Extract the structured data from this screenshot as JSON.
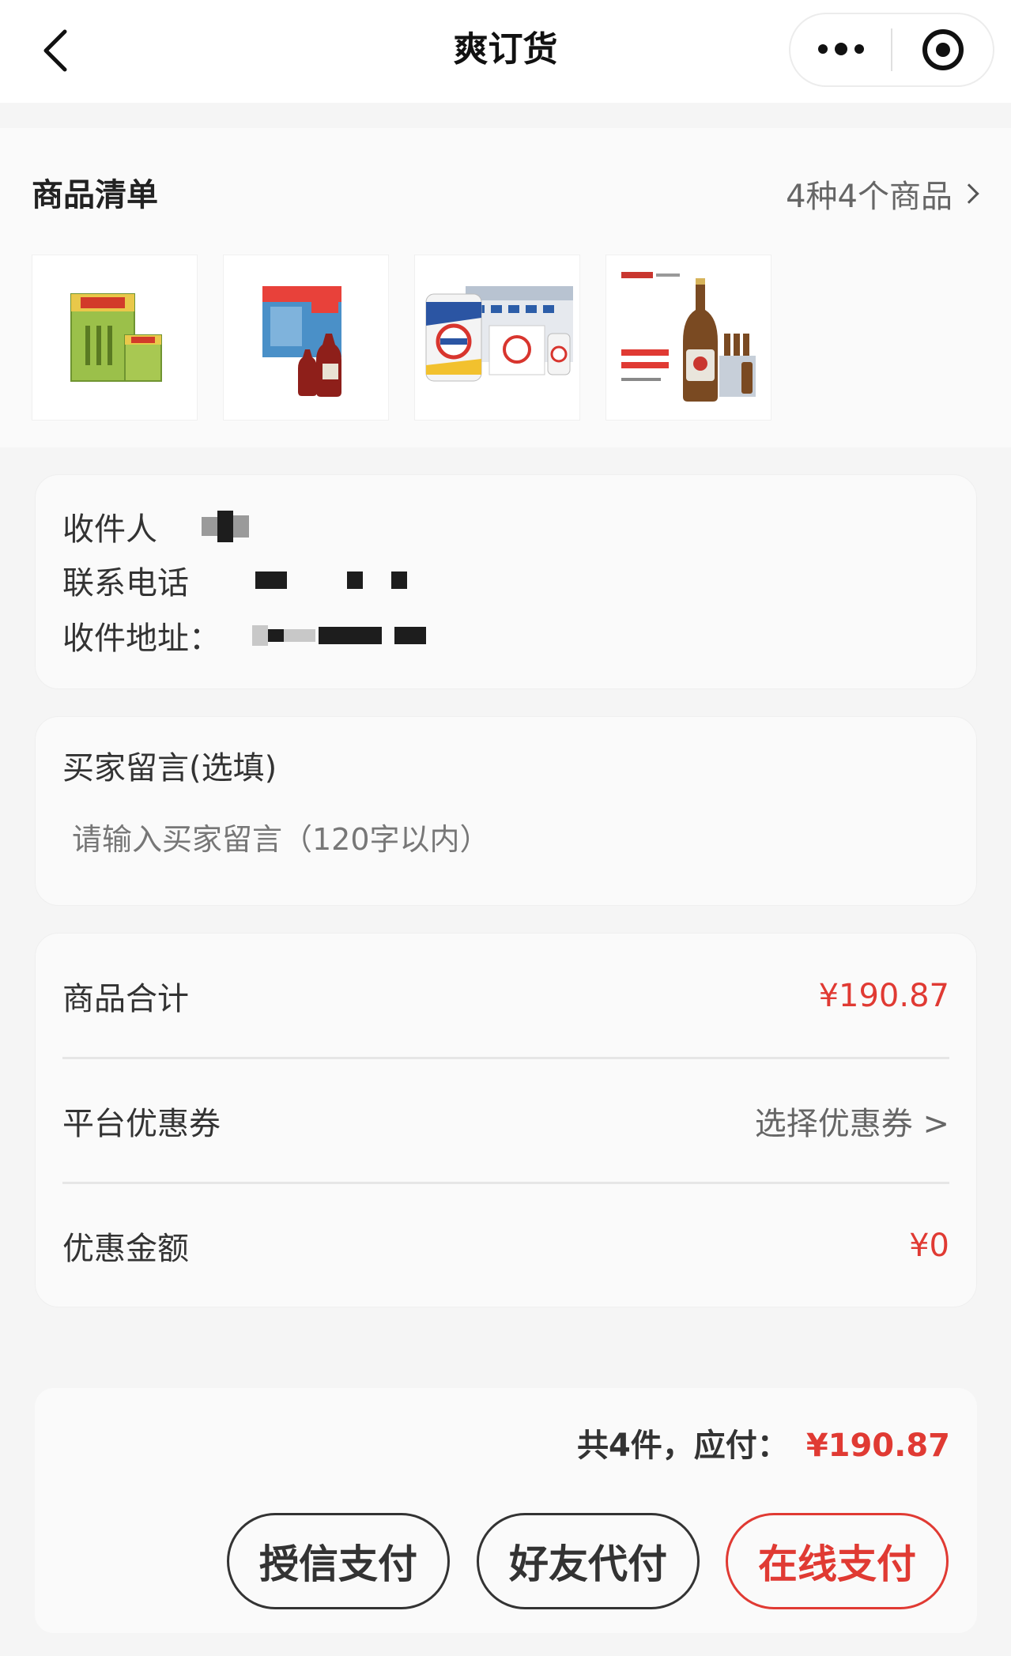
{
  "nav": {
    "title": "爽订货"
  },
  "products": {
    "title": "商品清单",
    "count": "4种4个商品",
    "items": [
      {
        "icon": "herbal-tea-box-image"
      },
      {
        "icon": "herbal-tea-bottle-image"
      },
      {
        "icon": "beer-can-pack-image"
      },
      {
        "icon": "beer-bottle-image"
      }
    ]
  },
  "address": {
    "recipient_label": "收件人",
    "phone_label": "联系电话",
    "address_label": "收件地址："
  },
  "memo": {
    "label": "买家留言(选填)",
    "placeholder": "请输入买家留言（120字以内）"
  },
  "summary": {
    "goods_total_label": "商品合计",
    "goods_total_value": "¥190.87",
    "coupon_label": "平台优惠券",
    "coupon_action": "选择优惠券 >",
    "discount_label": "优惠金额",
    "discount_value": "¥0"
  },
  "pay": {
    "total_text": "共4件，应付：",
    "total_amount": "¥190.87",
    "credit_button": "授信支付",
    "friend_button": "好友代付",
    "online_button": "在线支付"
  },
  "colors": {
    "accent_red": "#e03a33"
  }
}
